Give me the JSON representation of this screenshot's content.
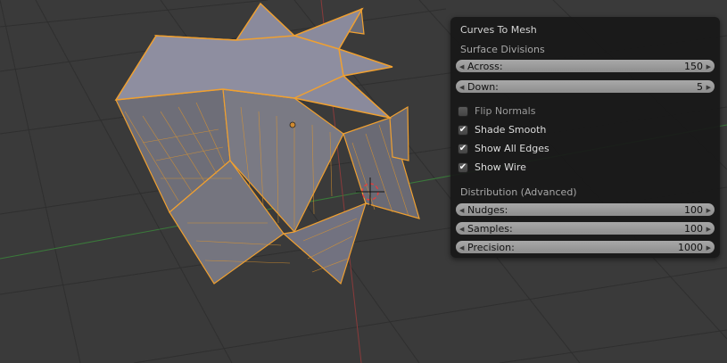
{
  "panel": {
    "title": "Curves To Mesh",
    "surface_divisions": {
      "heading": "Surface Divisions",
      "across": {
        "label": "Across:",
        "value": "150"
      },
      "down": {
        "label": "Down:",
        "value": "5"
      }
    },
    "options": [
      {
        "label": "Flip Normals",
        "checked": false
      },
      {
        "label": "Shade Smooth",
        "checked": true
      },
      {
        "label": "Show All Edges",
        "checked": true
      },
      {
        "label": "Show Wire",
        "checked": true
      }
    ],
    "distribution": {
      "heading": "Distribution (Advanced)",
      "nudges": {
        "label": "Nudges:",
        "value": "100"
      },
      "samples": {
        "label": "Samples:",
        "value": "100"
      },
      "precision": {
        "label": "Precision:",
        "value": "1000"
      }
    }
  },
  "colors": {
    "viewport_bg": "#3a3a3a",
    "selection_orange": "#f0a030",
    "mesh_face": "#8a8a9c",
    "x_axis": "#8a3a3a",
    "y_axis": "#3a7a3a"
  },
  "icons": [
    "star-mesh-object",
    "3d-cursor-icon",
    "origin-dot-icon",
    "checkmark-icon",
    "arrow-left-icon",
    "arrow-right-icon"
  ]
}
